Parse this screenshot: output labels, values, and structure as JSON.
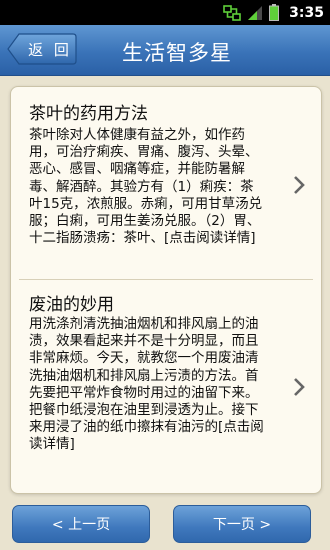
{
  "status_bar": {
    "time": "3:35",
    "icons": [
      "sync-icon",
      "signal-icon",
      "battery-icon"
    ]
  },
  "header": {
    "back_label": "返 回",
    "title": "生活智多星"
  },
  "articles": [
    {
      "title": "茶叶的药用方法",
      "body": "茶叶除对人体健康有益之外，如作药用，可治疗痢疾、胃痛、腹泻、头晕、恶心、感冒、咽痛等症，并能防暑解毒、解酒醉。其验方有（1）痢疾：茶叶15克，浓煎服。赤痢，可用甘草汤兑服；白痢，可用生姜汤兑服。（2）胃、十二指肠溃疡：茶叶、[点击阅读详情]"
    },
    {
      "title": "废油的妙用",
      "body": "用洗涤剂清洗抽油烟机和排风扇上的油渍，效果看起来并不是十分明显，而且非常麻烦。今天，就教您一个用废油清洗抽油烟机和排风扇上污渍的方法。首先要把平常炸食物时用过的油留下来。把餐巾纸浸泡在油里到浸透为止。接下来用浸了油的纸巾擦抹有油污的[点击阅读详情]"
    }
  ],
  "footer": {
    "prev_label": "< 上一页",
    "next_label": "下一页 >"
  },
  "colors": {
    "header_blue": "#3a73b8",
    "background": "#e9e3cf",
    "card": "#fdfaf0"
  }
}
